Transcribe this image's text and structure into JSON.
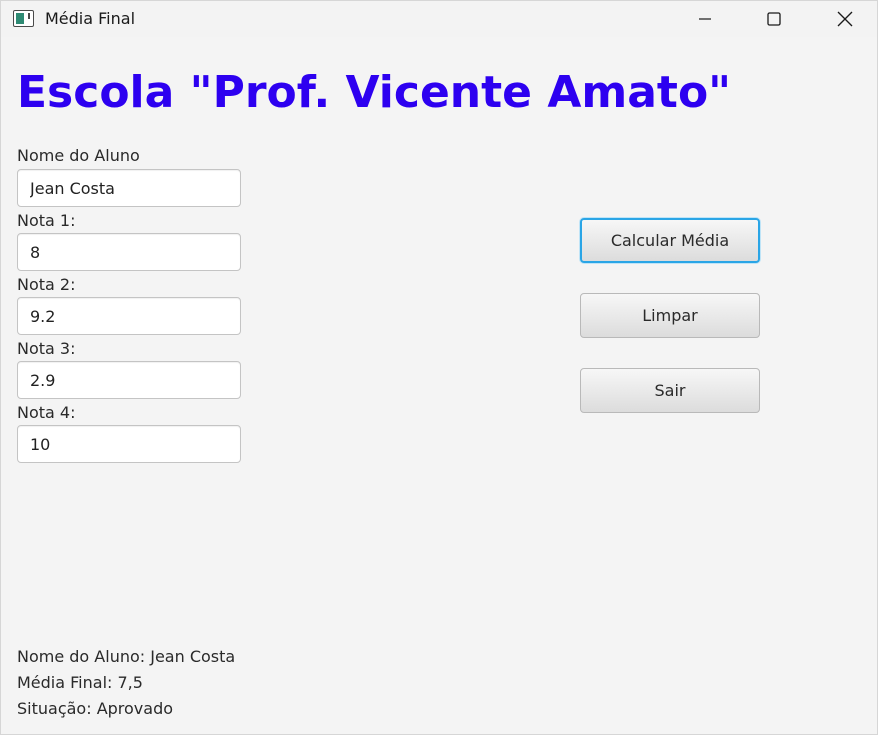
{
  "window": {
    "title": "Média Final",
    "icon": "java-app-icon"
  },
  "heading": "Escola \"Prof. Vicente Amato\"",
  "form": {
    "nome_label": "Nome do Aluno",
    "nome_value": "Jean Costa",
    "nota1_label": "Nota 1:",
    "nota1_value": "8",
    "nota2_label": "Nota 2:",
    "nota2_value": "9.2",
    "nota3_label": "Nota 3:",
    "nota3_value": "2.9",
    "nota4_label": "Nota 4:",
    "nota4_value": "10"
  },
  "buttons": {
    "calcular": "Calcular Média",
    "limpar": "Limpar",
    "sair": "Sair"
  },
  "results": {
    "nome": "Nome do Aluno: Jean Costa",
    "media": "Média Final: 7,5",
    "situacao": "Situação: Aprovado"
  },
  "colors": {
    "heading": "#2d00f0",
    "focus_ring": "#2aa5e6"
  }
}
